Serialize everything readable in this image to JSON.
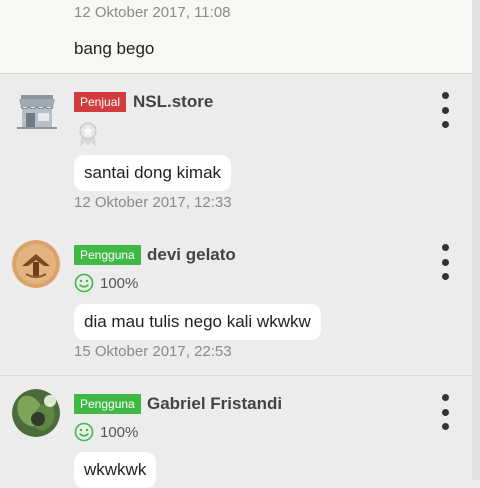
{
  "top_comment": {
    "timestamp": "12 Oktober 2017, 11:08",
    "message": "bang bego"
  },
  "comments": [
    {
      "role_badge": "Penjual",
      "role_color": "#d23c3c",
      "username": "NSL.store",
      "message": "santai dong kimak",
      "timestamp": "12 Oktober 2017, 12:33",
      "avatar_icon": "store-icon",
      "rank_icon": "medal-icon"
    },
    {
      "role_badge": "Pengguna",
      "role_color": "#3fb846",
      "username": "devi gelato",
      "rating": "100%",
      "message": "dia mau tulis nego kali wkwkw",
      "timestamp": "15 Oktober 2017, 22:53",
      "avatar_icon": "user-avatar"
    },
    {
      "role_badge": "Pengguna",
      "role_color": "#3fb846",
      "username": "Gabriel Fristandi",
      "rating": "100%",
      "message": "wkwkwk",
      "avatar_icon": "user-avatar"
    }
  ],
  "icons": {
    "menu": "more-vertical-icon",
    "rating": "smiley-icon"
  }
}
